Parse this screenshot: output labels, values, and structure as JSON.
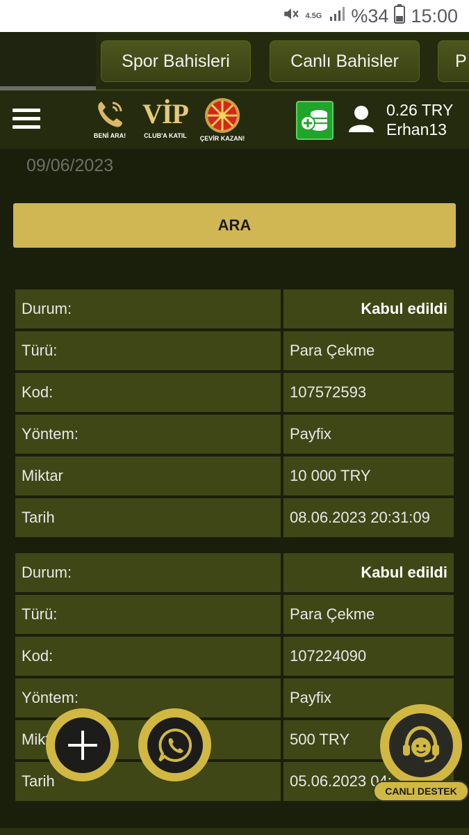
{
  "status_bar": {
    "network": "4.5G",
    "battery": "%34",
    "time": "15:00"
  },
  "top_nav": {
    "tabs": [
      {
        "label": "Spor Bahisleri"
      },
      {
        "label": "Canlı Bahisler"
      },
      {
        "label": "P"
      }
    ]
  },
  "header": {
    "promos": {
      "call": "BENİ ARA!",
      "vip_logo": "VİP",
      "vip": "CLUB'A KATIL",
      "wheel": "ÇEVİR KAZAN!"
    },
    "balance": "0.26 TRY",
    "username": "Erhan13"
  },
  "filter": {
    "date_value": "09/06/2023",
    "search_label": "ARA"
  },
  "transactions": [
    {
      "status_label": "Durum:",
      "status": "Kabul edildi",
      "type_label": "Türü:",
      "type": "Para Çekme",
      "code_label": "Kod:",
      "code": "107572593",
      "method_label": "Yöntem:",
      "method": "Payfix",
      "amount_label": "Miktar",
      "amount": "10 000 TRY",
      "date_label": "Tarih",
      "date": "08.06.2023 20:31:09"
    },
    {
      "status_label": "Durum:",
      "status": "Kabul edildi",
      "type_label": "Türü:",
      "type": "Para Çekme",
      "code_label": "Kod:",
      "code": "107224090",
      "method_label": "Yöntem:",
      "method": "Payfix",
      "amount_label": "Miktar",
      "amount": "500 TRY",
      "date_label": "Tarih",
      "date": "05.06.2023 04:"
    }
  ],
  "support": {
    "label": "CANLI DESTEK"
  },
  "colors": {
    "accent": "#d1b654",
    "cell": "#3f4716",
    "background": "#1a1f0c"
  }
}
